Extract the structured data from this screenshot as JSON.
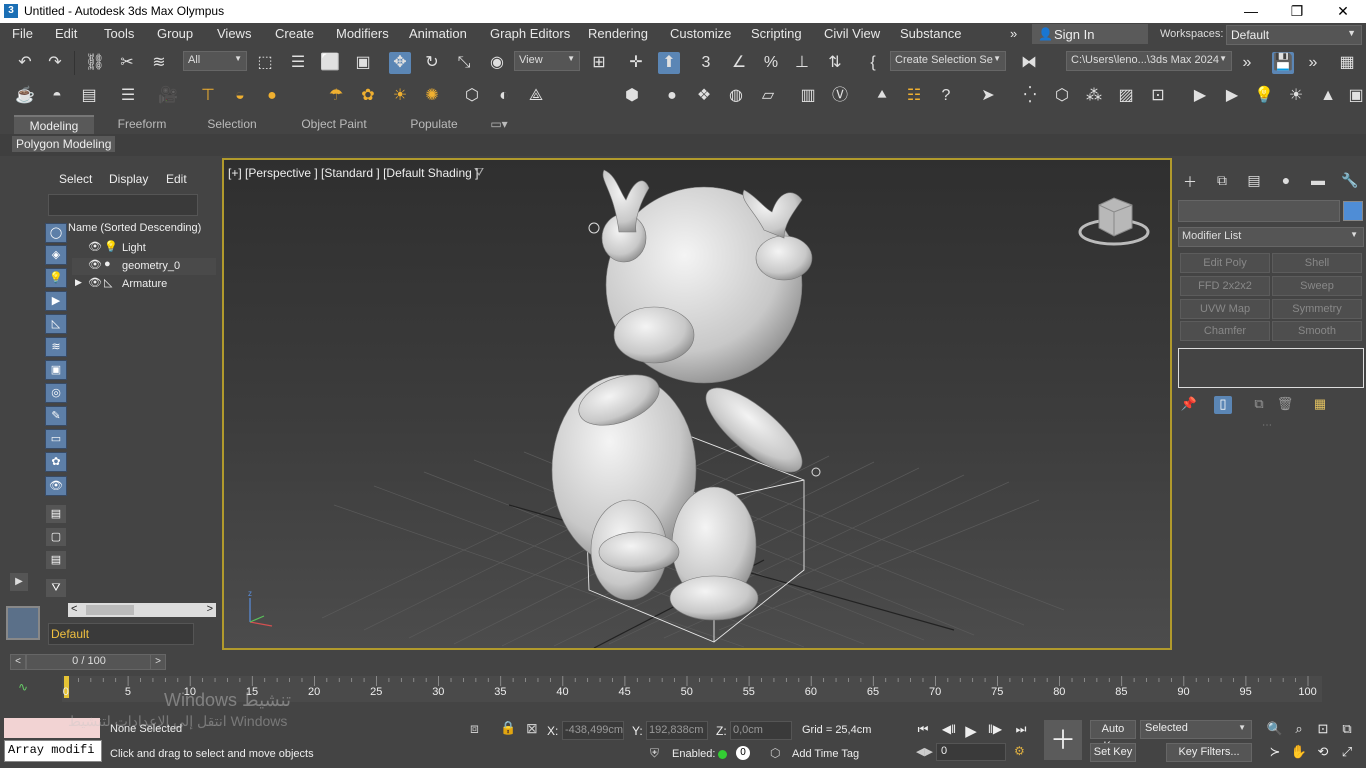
{
  "window": {
    "title": "Untitled - Autodesk 3ds Max Olympus",
    "app_icon_text": "3",
    "minimize": "—",
    "restore": "❐",
    "close": "✕"
  },
  "menu": {
    "items": [
      "File",
      "Edit",
      "Tools",
      "Group",
      "Views",
      "Create",
      "Modifiers",
      "Animation",
      "Graph Editors",
      "Rendering",
      "Customize",
      "Scripting",
      "Civil View",
      "Substance"
    ],
    "overflow": "»",
    "sign_in": "Sign In",
    "workspaces_label": "Workspaces:",
    "workspace_value": "Default"
  },
  "toolbar": {
    "selection_filter": "All",
    "ref_coord": "View",
    "named_selection": "Create Selection Se",
    "project_path": "C:\\Users\\leno...\\3ds Max 2024"
  },
  "ribbon": {
    "tabs": [
      "Modeling",
      "Freeform",
      "Selection",
      "Object Paint",
      "Populate"
    ],
    "active_tab": "Modeling",
    "sub_label": "Polygon Modeling"
  },
  "scene_explorer": {
    "menus": [
      "Select",
      "Display",
      "Edit"
    ],
    "column_header": "Name (Sorted Descending)",
    "rows": [
      {
        "name": "Light",
        "type_icon": "💡",
        "expandable": false
      },
      {
        "name": "geometry_0",
        "type_icon": "●",
        "expandable": false
      },
      {
        "name": "Armature",
        "type_icon": "◺",
        "expandable": true
      }
    ],
    "layer": "Default"
  },
  "viewport": {
    "label": "[+] [Perspective ] [Standard ] [Default Shading ]",
    "filter_icon": "funnel-icon"
  },
  "command_panel": {
    "modifier_list": "Modifier List",
    "modifier_buttons": [
      "Edit Poly",
      "Shell",
      "FFD 2x2x2",
      "Sweep",
      "UVW Map",
      "Symmetry",
      "Chamfer",
      "Smooth"
    ],
    "object_color": "#4f8dd6"
  },
  "timeline": {
    "frame_display": "0 / 100",
    "tick_labels": [
      "0",
      "5",
      "10",
      "15",
      "20",
      "25",
      "30",
      "35",
      "40",
      "45",
      "50",
      "55",
      "60",
      "65",
      "70",
      "75",
      "80",
      "85",
      "90",
      "95",
      "100"
    ],
    "current_frame": 0,
    "total_frames": 100
  },
  "status": {
    "maxscript_label": "Array modifi",
    "selection_status": "None Selected",
    "prompt": "Click and drag to select and move objects",
    "x_label": "X:",
    "x_value": "-438,499cm",
    "y_label": "Y:",
    "y_value": "192,838cm",
    "z_label": "Z:",
    "z_value": "0,0cm",
    "grid": "Grid = 25,4cm",
    "enabled_label": "Enabled:",
    "enabled_value": "0",
    "add_time_tag": "Add Time Tag",
    "frame_value": "0",
    "auto_key": "Auto Key",
    "set_key": "Set Key",
    "key_mode": "Selected",
    "key_filters": "Key Filters..."
  },
  "watermark": {
    "line1": "Windows تنشيط",
    "line2": "انتقل إلى الإعدادات لتنشيط Windows"
  },
  "colors": {
    "accent": "#5b86b5",
    "viewport_border": "#b19a2c",
    "layer_text": "#f0c040"
  }
}
